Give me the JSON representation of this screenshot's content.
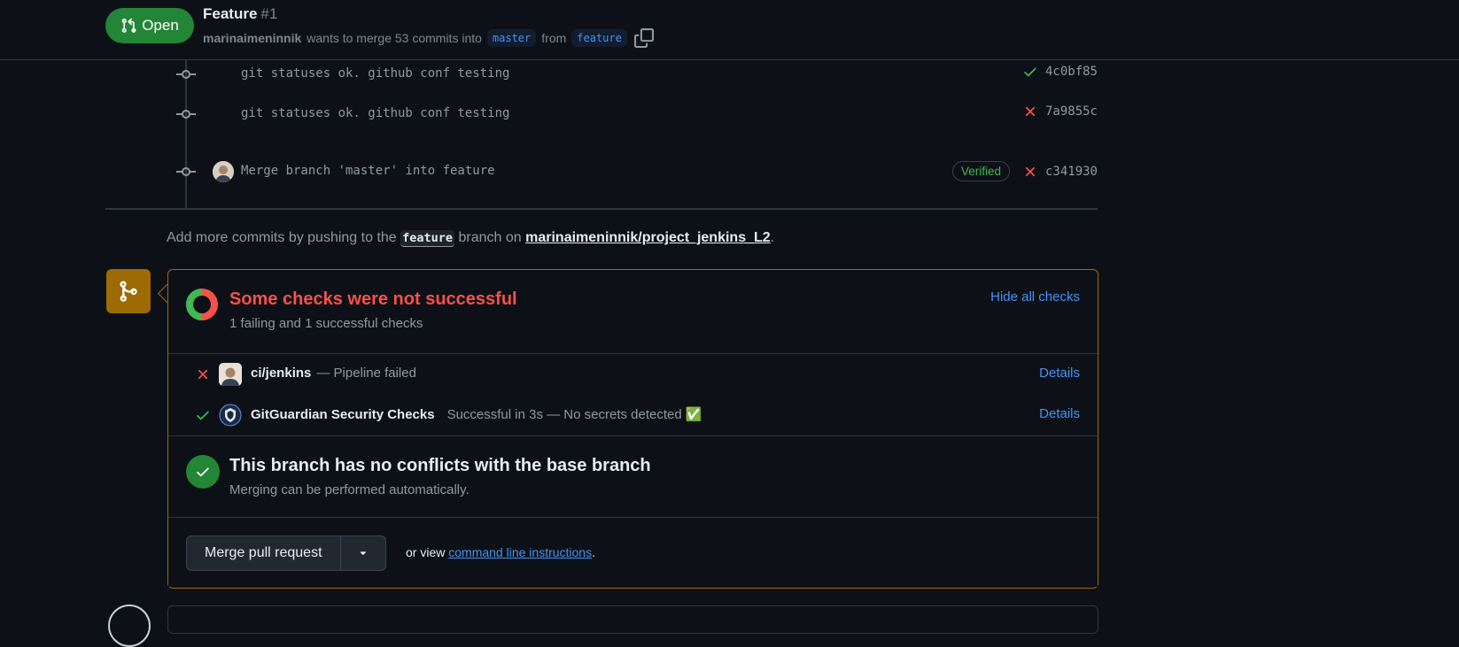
{
  "header": {
    "state_label": "Open",
    "title": "Feature",
    "number": "#1",
    "author": "marinaimeninnik",
    "merge_text": "wants to merge 53 commits into",
    "base_branch": "master",
    "from_text": "from",
    "head_branch": "feature"
  },
  "commits": [
    {
      "message": "git statuses ok. github conf testing",
      "status": "success",
      "sha": "4c0bf85"
    },
    {
      "message": "git statuses ok. github conf testing",
      "status": "failure",
      "sha": "7a9855c"
    },
    {
      "message": "Merge branch 'master' into feature",
      "status": "failure",
      "sha": "c341930",
      "verified_label": "Verified"
    }
  ],
  "push_hint": {
    "prefix": "Add more commits by pushing to the",
    "branch": "feature",
    "middle": "branch on",
    "repo": "marinaimeninnik/project_jenkins_L2",
    "suffix": "."
  },
  "checks": {
    "title": "Some checks were not successful",
    "subtitle": "1 failing and 1 successful checks",
    "hide_label": "Hide all checks",
    "items": [
      {
        "status": "failure",
        "name": "ci/jenkins",
        "description": "— Pipeline failed",
        "details_label": "Details"
      },
      {
        "status": "success",
        "name": "GitGuardian Security Checks",
        "description": "Successful in 3s — No secrets detected ✅",
        "details_label": "Details"
      }
    ]
  },
  "conflicts": {
    "title": "This branch has no conflicts with the base branch",
    "subtitle": "Merging can be performed automatically."
  },
  "merge": {
    "button_label": "Merge pull request",
    "or_view": "or view",
    "cli_link": "command line instructions",
    "suffix": "."
  },
  "colors": {
    "success": "#3fb950",
    "failure": "#f85149",
    "accent": "#4493f8",
    "warning_border": "#9e6a03",
    "open_badge": "#238636"
  }
}
